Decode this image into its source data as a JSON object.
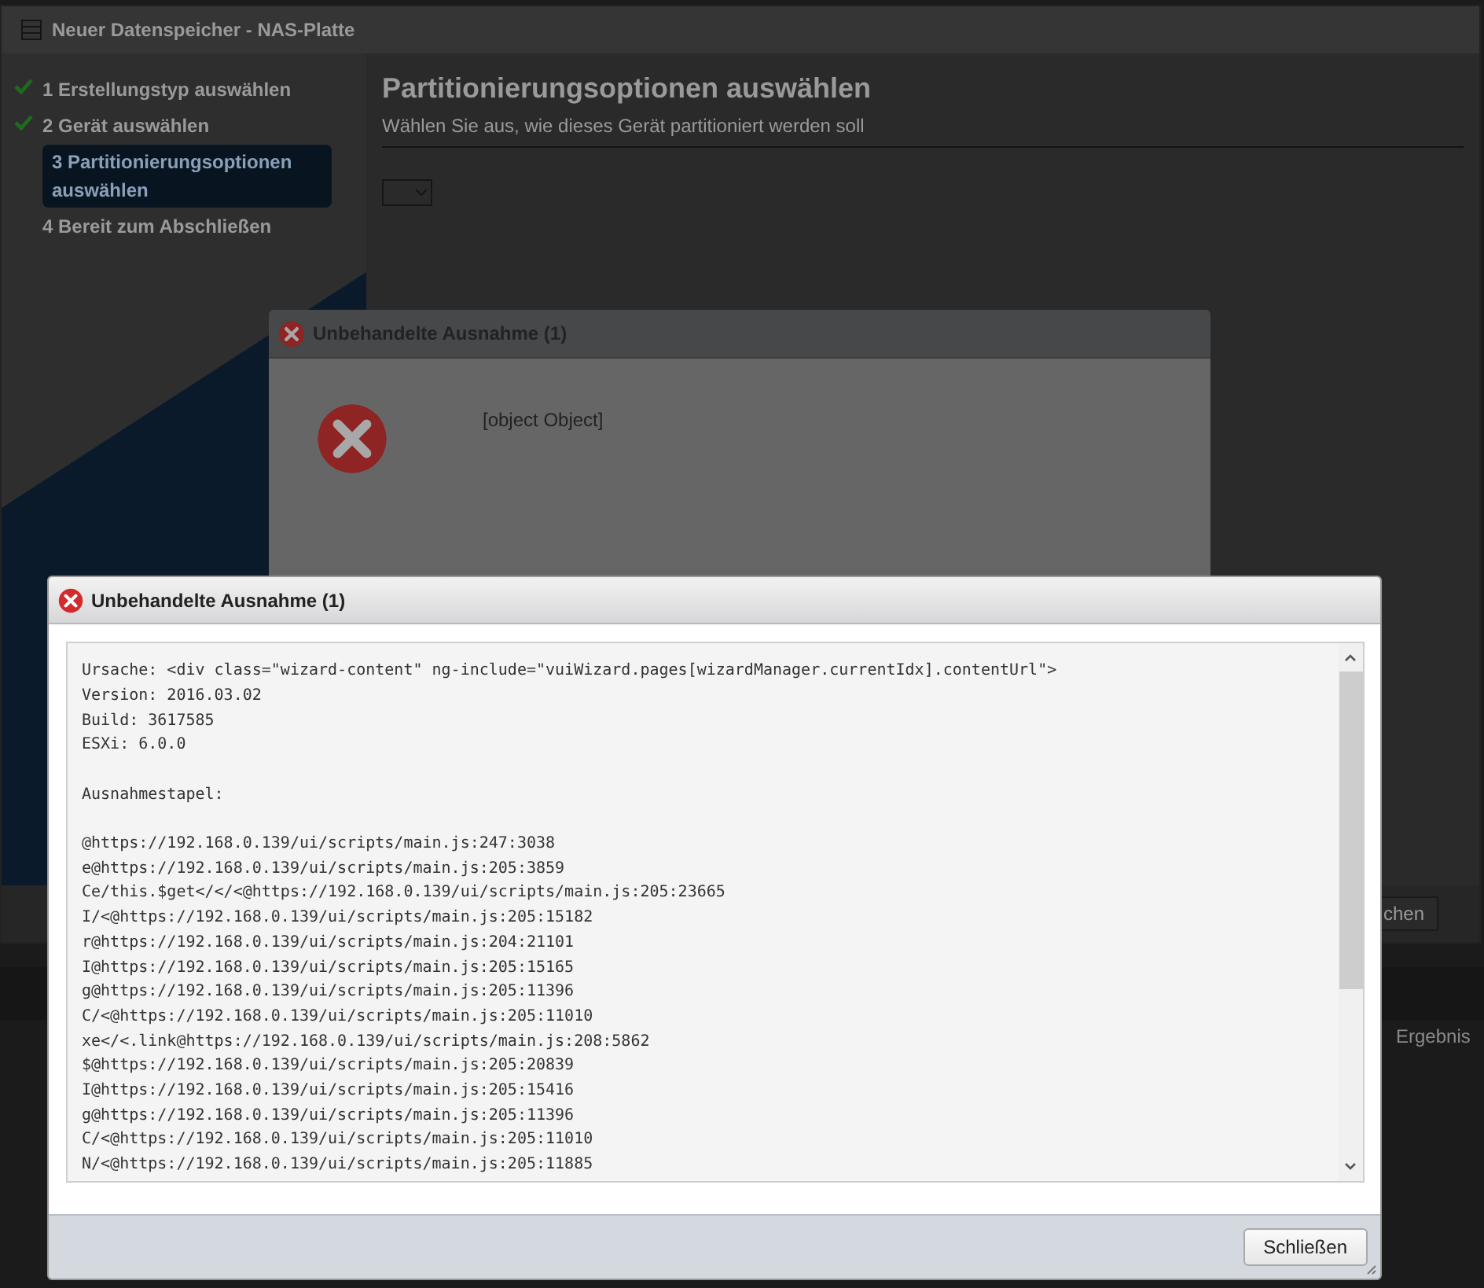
{
  "wizard": {
    "title": "Neuer Datenspeicher - NAS-Platte",
    "steps": [
      {
        "label": "1 Erstellungstyp auswählen",
        "done": true,
        "selected": false
      },
      {
        "label": "2 Gerät auswählen",
        "done": true,
        "selected": false
      },
      {
        "label": "3 Partitionierungsoptionen auswählen",
        "done": false,
        "selected": true
      },
      {
        "label": "4 Bereit zum Abschließen",
        "done": false,
        "selected": false
      }
    ],
    "heading": "Partitionierungsoptionen auswählen",
    "subtitle": "Wählen Sie aus, wie dieses Gerät partitioniert werden soll",
    "footer_button": "chen"
  },
  "background_label": "Ergebnis",
  "error_dialog_back": {
    "title": "Unbehandelte Ausnahme (1)",
    "message": "[object Object]"
  },
  "error_dialog_front": {
    "title": "Unbehandelte Ausnahme (1)",
    "info_lines": [
      "Ursache: <div class=\"wizard-content\" ng-include=\"vuiWizard.pages[wizardManager.currentIdx].contentUrl\">",
      "Version: 2016.03.02",
      "Build: 3617585",
      "ESXi: 6.0.0"
    ],
    "stack_heading": "Ausnahmestapel:",
    "stack_lines": [
      "@https://192.168.0.139/ui/scripts/main.js:247:3038",
      "e@https://192.168.0.139/ui/scripts/main.js:205:3859",
      "Ce/this.$get</</<@https://192.168.0.139/ui/scripts/main.js:205:23665",
      "I/<@https://192.168.0.139/ui/scripts/main.js:205:15182",
      "r@https://192.168.0.139/ui/scripts/main.js:204:21101",
      "I@https://192.168.0.139/ui/scripts/main.js:205:15165",
      "g@https://192.168.0.139/ui/scripts/main.js:205:11396",
      "C/<@https://192.168.0.139/ui/scripts/main.js:205:11010",
      "xe</<.link@https://192.168.0.139/ui/scripts/main.js:208:5862",
      "$@https://192.168.0.139/ui/scripts/main.js:205:20839",
      "I@https://192.168.0.139/ui/scripts/main.js:205:15416",
      "g@https://192.168.0.139/ui/scripts/main.js:205:11396",
      "C/<@https://192.168.0.139/ui/scripts/main.js:205:11010",
      "N/<@https://192.168.0.139/ui/scripts/main.js:205:11885"
    ],
    "close_button": "Schließen"
  }
}
